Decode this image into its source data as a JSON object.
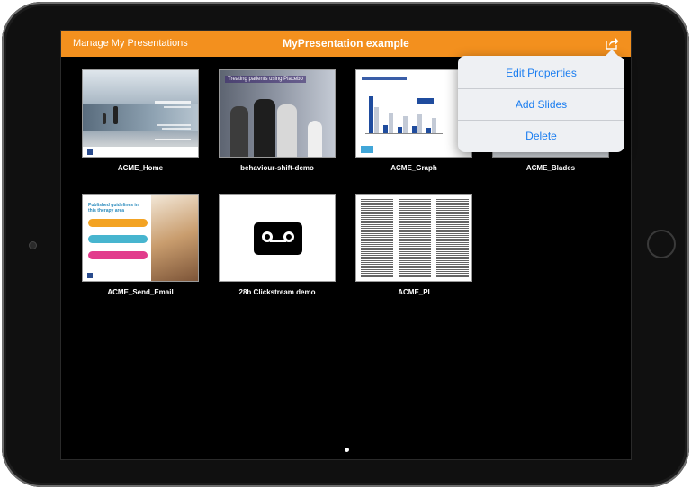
{
  "navbar": {
    "back_label": "Manage My Presentations",
    "title": "MyPresentation example"
  },
  "slides": [
    {
      "name": "ACME_Home"
    },
    {
      "name": "behaviour-shift-demo",
      "thumb_banner": "Treating patients using Placebo"
    },
    {
      "name": "ACME_Graph"
    },
    {
      "name": "ACME_Blades"
    },
    {
      "name": "ACME_Send_Email",
      "thumb_title": "Published guidelines in this therapy area"
    },
    {
      "name": "28b Clickstream demo"
    },
    {
      "name": "ACME_PI"
    }
  ],
  "popover": {
    "items": [
      "Edit Properties",
      "Add Slides",
      "Delete"
    ]
  },
  "colors": {
    "navbar": "#f3901e",
    "accent_link": "#1a7df0",
    "background": "#000000"
  },
  "icons": {
    "share": "share-icon",
    "cassette": "voicemail-icon"
  }
}
